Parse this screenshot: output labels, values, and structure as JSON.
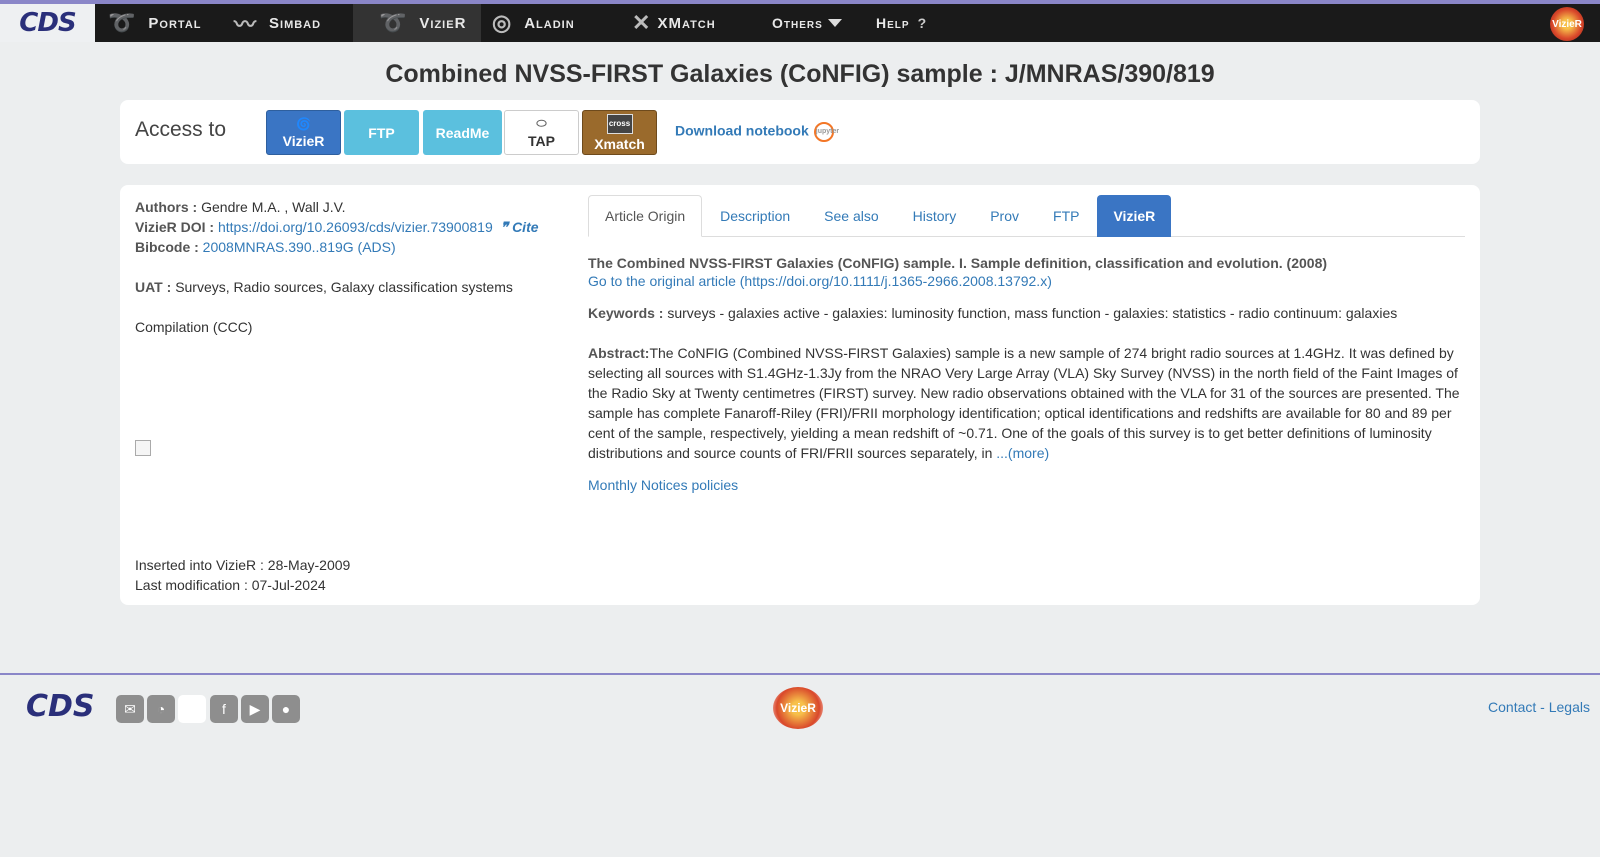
{
  "nav": {
    "items": [
      {
        "label": "Portal",
        "icon": "swirl-icon"
      },
      {
        "label": "Simbad",
        "icon": "swirl-icon"
      },
      {
        "label": "VizieR",
        "icon": "swirl-icon"
      },
      {
        "label": "Aladin",
        "icon": "galaxy-icon"
      },
      {
        "label": "XMatch",
        "icon": "x-icon"
      }
    ],
    "others_label": "Others",
    "help_label": "Help",
    "help_mark": "?",
    "cds_logo": "CDS",
    "vizier_logo": "VizieR"
  },
  "page": {
    "title": "Combined NVSS-FIRST Galaxies (CoNFIG) sample : J/MNRAS/390/819"
  },
  "access": {
    "label": "Access to",
    "buttons": {
      "vizier": "VizieR",
      "ftp": "FTP",
      "readme": "ReadMe",
      "tap": "TAP",
      "xmatch": "Xmatch",
      "xmatch_icon_text": "cross"
    },
    "notebook": "Download notebook",
    "jupyter": "jupyter"
  },
  "meta": {
    "authors_label": "Authors :",
    "authors": "Gendre M.A. , Wall J.V.",
    "doi_label": "VizieR DOI :",
    "doi": "https://doi.org/10.26093/cds/vizier.73900819",
    "cite": "Cite",
    "bibcode_label": "Bibcode :",
    "bibcode": "2008MNRAS.390..819G (ADS)",
    "uat_label": "UAT :",
    "uat": "Surveys, Radio sources, Galaxy classification systems",
    "compilation": "Compilation (CCC)",
    "inserted": "Inserted into VizieR : 28-May-2009",
    "modified": "Last modification : 07-Jul-2024"
  },
  "tabs": [
    "Article Origin",
    "Description",
    "See also",
    "History",
    "Prov",
    "FTP",
    "VizieR"
  ],
  "article": {
    "title": "The Combined NVSS-FIRST Galaxies (CoNFIG) sample. I. Sample definition, classification and evolution. (2008)",
    "original_link": "Go to the original article (https://doi.org/10.1111/j.1365-2966.2008.13792.x)",
    "keywords_label": "Keywords :",
    "keywords": "surveys - galaxies active - galaxies: luminosity function, mass function - galaxies: statistics - radio continuum: galaxies",
    "abstract_label": "Abstract:",
    "abstract": "The CoNFIG (Combined NVSS-FIRST Galaxies) sample is a new sample of 274 bright radio sources at 1.4GHz. It was defined by selecting all sources with S1.4GHz-1.3Jy from the NRAO Very Large Array (VLA) Sky Survey (NVSS) in the north field of the Faint Images of the Radio Sky at Twenty centimetres (FIRST) survey. New radio observations obtained with the VLA for 31 of the sources are presented. The sample has complete Fanaroff-Riley (FRI)/FRII morphology identification; optical identifications and redshifts are available for 80 and 89 per cent of the sample, respectively, yielding a mean redshift of ~0.71. One of the goals of this survey is to get better definitions of luminosity distributions and source counts of FRI/FRII sources separately, in",
    "more": "...(more)",
    "policies": "Monthly Notices policies"
  },
  "footer": {
    "cds_logo": "CDS",
    "vizier_logo": "VizieR",
    "contact": "Contact",
    "separator": "-",
    "legals": "Legals"
  },
  "colors": {
    "nav_bg": "#1a1a1a",
    "accent_line": "#8a86c8",
    "link": "#337ab7",
    "vizier_button": "#3a75c4",
    "info_button": "#5bc0de",
    "xmatch_button": "#9a6a2c"
  }
}
